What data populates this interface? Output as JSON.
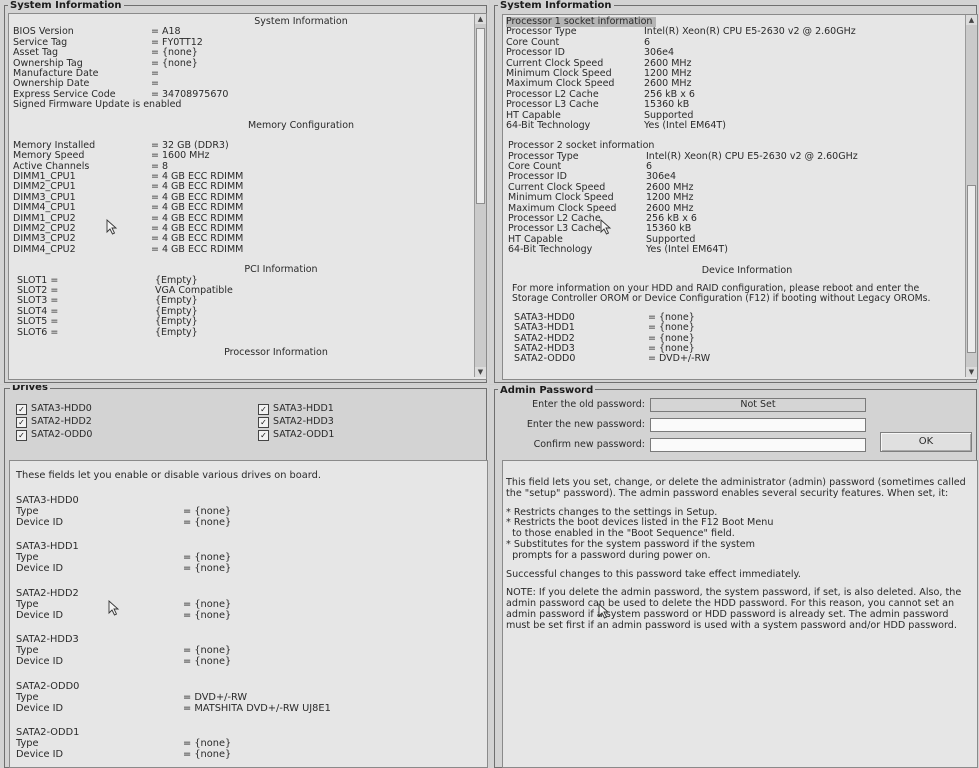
{
  "system_info": {
    "legend": "System Information",
    "section_system": "System Information",
    "system_rows": [
      {
        "label": "BIOS Version",
        "value": "= A18"
      },
      {
        "label": "Service Tag",
        "value": "= FY0TT12"
      },
      {
        "label": "Asset Tag",
        "value": "= {none}"
      },
      {
        "label": "Ownership Tag",
        "value": "= {none}"
      },
      {
        "label": "Manufacture Date",
        "value": "="
      },
      {
        "label": "Ownership Date",
        "value": "="
      },
      {
        "label": "Express Service Code",
        "value": "= 34708975670"
      }
    ],
    "firmware_note": "Signed Firmware Update is enabled",
    "section_memory": "Memory Configuration",
    "memory_rows": [
      {
        "label": "Memory Installed",
        "value": "= 32 GB (DDR3)"
      },
      {
        "label": "Memory Speed",
        "value": "= 1600 MHz"
      },
      {
        "label": "Active Channels",
        "value": "= 8"
      },
      {
        "label": "DIMM1_CPU1",
        "value": "= 4 GB ECC RDIMM"
      },
      {
        "label": "DIMM2_CPU1",
        "value": "= 4 GB ECC RDIMM"
      },
      {
        "label": "DIMM3_CPU1",
        "value": "= 4 GB ECC RDIMM"
      },
      {
        "label": "DIMM4_CPU1",
        "value": "= 4 GB ECC RDIMM"
      },
      {
        "label": "DIMM1_CPU2",
        "value": "= 4 GB ECC RDIMM"
      },
      {
        "label": "DIMM2_CPU2",
        "value": "= 4 GB ECC RDIMM"
      },
      {
        "label": "DIMM3_CPU2",
        "value": "= 4 GB ECC RDIMM"
      },
      {
        "label": "DIMM4_CPU2",
        "value": "= 4 GB ECC RDIMM"
      }
    ],
    "section_pci": "PCI Information",
    "pci_rows": [
      {
        "label": "SLOT1 =",
        "value": "{Empty}"
      },
      {
        "label": "SLOT2 =",
        "value": "VGA Compatible"
      },
      {
        "label": "SLOT3 =",
        "value": "{Empty}"
      },
      {
        "label": "SLOT4 =",
        "value": "{Empty}"
      },
      {
        "label": "SLOT5 =",
        "value": "{Empty}"
      },
      {
        "label": "SLOT6 =",
        "value": "{Empty}"
      }
    ],
    "section_processor": "Processor Information"
  },
  "processor_info": {
    "legend": "System Information",
    "proc1_header": "Processor 1 socket information",
    "proc1_rows": [
      {
        "label": "Processor Type",
        "value": "Intel(R) Xeon(R) CPU E5-2630 v2 @ 2.60GHz"
      },
      {
        "label": "Core Count",
        "value": "6"
      },
      {
        "label": "Processor ID",
        "value": "306e4"
      },
      {
        "label": "Current Clock Speed",
        "value": "2600 MHz"
      },
      {
        "label": "Minimum Clock Speed",
        "value": "1200 MHz"
      },
      {
        "label": "Maximum Clock Speed",
        "value": "2600 MHz"
      },
      {
        "label": "Processor L2 Cache",
        "value": "256 kB x 6"
      },
      {
        "label": "Processor L3 Cache",
        "value": "15360 kB"
      },
      {
        "label": "HT Capable",
        "value": "Supported"
      },
      {
        "label": "64-Bit Technology",
        "value": "Yes (Intel EM64T)"
      }
    ],
    "proc2_header": "Processor 2 socket information",
    "proc2_rows": [
      {
        "label": "Processor Type",
        "value": "Intel(R) Xeon(R) CPU E5-2630 v2 @ 2.60GHz"
      },
      {
        "label": "Core Count",
        "value": "6"
      },
      {
        "label": "Processor ID",
        "value": "306e4"
      },
      {
        "label": "Current Clock Speed",
        "value": "2600 MHz"
      },
      {
        "label": "Minimum Clock Speed",
        "value": "1200 MHz"
      },
      {
        "label": "Maximum Clock Speed",
        "value": "2600 MHz"
      },
      {
        "label": "Processor L2 Cache",
        "value": "256 kB x 6"
      },
      {
        "label": "Processor L3 Cache",
        "value": "15360 kB"
      },
      {
        "label": "HT Capable",
        "value": "Supported"
      },
      {
        "label": "64-Bit Technology",
        "value": "Yes (Intel EM64T)"
      }
    ],
    "section_device": "Device Information",
    "device_note": "For more information on your HDD and RAID configuration, please reboot and enter the Storage Controller OROM or Device Configuration (F12) if booting without Legacy OROMs.",
    "device_rows": [
      {
        "label": "SATA3-HDD0",
        "value": "= {none}"
      },
      {
        "label": "SATA3-HDD1",
        "value": "= {none}"
      },
      {
        "label": "SATA2-HDD2",
        "value": "= {none}"
      },
      {
        "label": "SATA2-HDD3",
        "value": "= {none}"
      },
      {
        "label": "SATA2-ODD0",
        "value": "= DVD+/-RW"
      }
    ]
  },
  "drives": {
    "legend": "Drives",
    "checkboxes": [
      {
        "label": "SATA3-HDD0",
        "checked": true
      },
      {
        "label": "SATA2-HDD2",
        "checked": true
      },
      {
        "label": "SATA2-ODD0",
        "checked": true
      },
      {
        "label": "SATA3-HDD1",
        "checked": true
      },
      {
        "label": "SATA2-HDD3",
        "checked": true
      },
      {
        "label": "SATA2-ODD1",
        "checked": true
      }
    ],
    "check_mark": "✓",
    "help_text": "These fields let you enable or disable various drives on board.",
    "details": [
      {
        "name": "SATA3-HDD0",
        "type_label": "Type",
        "type_value": "= {none}",
        "id_label": "Device ID",
        "id_value": "= {none}"
      },
      {
        "name": "SATA3-HDD1",
        "type_label": "Type",
        "type_value": "= {none}",
        "id_label": "Device ID",
        "id_value": "= {none}"
      },
      {
        "name": "SATA2-HDD2",
        "type_label": "Type",
        "type_value": "= {none}",
        "id_label": "Device ID",
        "id_value": "= {none}"
      },
      {
        "name": "SATA2-HDD3",
        "type_label": "Type",
        "type_value": "= {none}",
        "id_label": "Device ID",
        "id_value": "= {none}"
      },
      {
        "name": "SATA2-ODD0",
        "type_label": "Type",
        "type_value": "= DVD+/-RW",
        "id_label": "Device ID",
        "id_value": "= MATSHITA DVD+/-RW UJ8E1"
      },
      {
        "name": "SATA2-ODD1",
        "type_label": "Type",
        "type_value": "= {none}",
        "id_label": "Device ID",
        "id_value": "= {none}"
      }
    ]
  },
  "admin_password": {
    "legend": "Admin Password",
    "old_label": "Enter the old password:",
    "old_value": "Not Set",
    "new_label": "Enter the new password:",
    "confirm_label": "Confirm new password:",
    "ok_label": "OK",
    "help_p1": "This field lets you set, change, or delete the administrator (admin) password (sometimes called the \"setup\" password).  The admin password enables several security features. When set, it:",
    "bullets": [
      "* Restricts changes to the settings in Setup.",
      "* Restricts the boot devices listed in the F12 Boot Menu",
      "  to those enabled in the \"Boot Sequence\" field.",
      "* Substitutes for the system password if the system",
      "  prompts for a password during power on."
    ],
    "help_p2": "Successful changes to this password take effect immediately.",
    "help_p3": "NOTE: If you delete the admin password, the system password, if set, is also deleted. Also, the admin password can be used to delete the HDD password.  For this reason, you cannot set an admin password if a system password or HDD password is already set. The admin password must be set first if an admin password is used with a system password and/or HDD password."
  },
  "icons": {
    "scroll_up": "▲",
    "scroll_down": "▼"
  }
}
